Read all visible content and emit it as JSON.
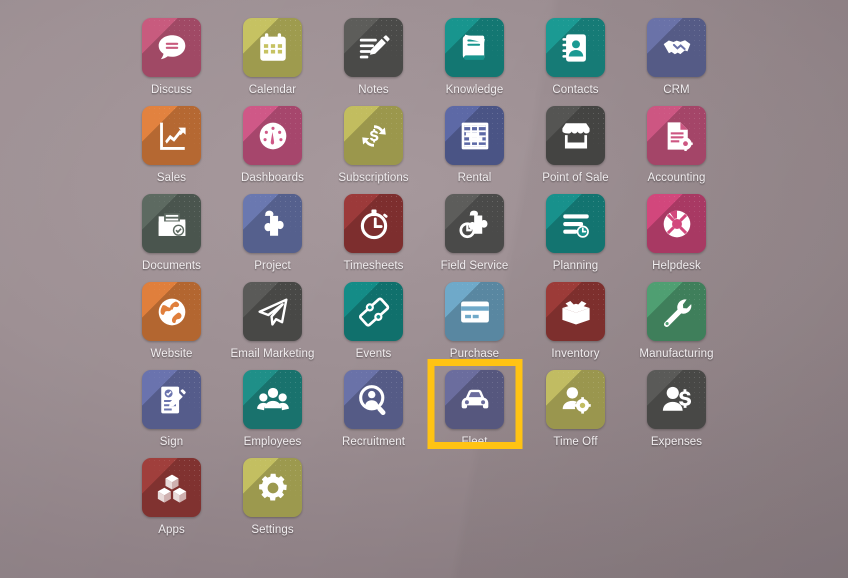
{
  "screen": {
    "type": "odoo-apps-home",
    "background_color": "#9a8c90",
    "highlight_color": "#ffc313",
    "highlighted_app": "Fleet",
    "columns": 6,
    "rows": 6
  },
  "apps": [
    {
      "label": "Discuss",
      "icon": "chat-bubble-icon",
      "color": "#c85b7e"
    },
    {
      "label": "Calendar",
      "icon": "calendar-icon",
      "color": "#c6c262"
    },
    {
      "label": "Notes",
      "icon": "note-pencil-icon",
      "color": "#5d5d5a"
    },
    {
      "label": "Knowledge",
      "icon": "book-icon",
      "color": "#18958e"
    },
    {
      "label": "Contacts",
      "icon": "address-book-icon",
      "color": "#1b9a93"
    },
    {
      "label": "CRM",
      "icon": "handshake-icon",
      "color": "#6a72a8"
    },
    {
      "label": "Sales",
      "icon": "growth-chart-icon",
      "color": "#e2823f"
    },
    {
      "label": "Dashboards",
      "icon": "gauge-icon",
      "color": "#cf5887"
    },
    {
      "label": "Subscriptions",
      "icon": "dollar-refresh-icon",
      "color": "#c2bd5f"
    },
    {
      "label": "Rental",
      "icon": "rental-grid-icon",
      "color": "#5d69a6"
    },
    {
      "label": "Point of Sale",
      "icon": "storefront-icon",
      "color": "#555553"
    },
    {
      "label": "Accounting",
      "icon": "invoice-gear-icon",
      "color": "#cd5682"
    },
    {
      "label": "Documents",
      "icon": "document-folder-icon",
      "color": "#5d6a61"
    },
    {
      "label": "Project",
      "icon": "puzzle-piece-icon",
      "color": "#6a78b0"
    },
    {
      "label": "Timesheets",
      "icon": "stopwatch-icon",
      "color": "#9c3a3a"
    },
    {
      "label": "Field Service",
      "icon": "puzzle-clock-icon",
      "color": "#5d5d5b"
    },
    {
      "label": "Planning",
      "icon": "planning-bars-icon",
      "color": "#18918c"
    },
    {
      "label": "Helpdesk",
      "icon": "lifebuoy-icon",
      "color": "#d2477c"
    },
    {
      "label": "Website",
      "icon": "globe-icon",
      "color": "#e07f3c"
    },
    {
      "label": "Email Marketing",
      "icon": "paper-plane-icon",
      "color": "#5a5a58"
    },
    {
      "label": "Events",
      "icon": "ticket-icon",
      "color": "#148c87"
    },
    {
      "label": "Purchase",
      "icon": "credit-card-icon",
      "color": "#6fa9c9"
    },
    {
      "label": "Inventory",
      "icon": "open-box-icon",
      "color": "#9c3b38"
    },
    {
      "label": "Manufacturing",
      "icon": "wrench-icon",
      "color": "#4f9f72"
    },
    {
      "label": "Sign",
      "icon": "signed-document-icon",
      "color": "#6a73ae"
    },
    {
      "label": "Employees",
      "icon": "people-group-icon",
      "color": "#1f8f88"
    },
    {
      "label": "Recruitment",
      "icon": "person-search-icon",
      "color": "#6a72a8"
    },
    {
      "label": "Fleet",
      "icon": "car-icon",
      "color": "#6b6d9e"
    },
    {
      "label": "Time Off",
      "icon": "person-gear-icon",
      "color": "#c1bc62"
    },
    {
      "label": "Expenses",
      "icon": "person-dollar-icon",
      "color": "#5a5a58"
    },
    {
      "label": "Apps",
      "icon": "cubes-icon",
      "color": "#a03f3c"
    },
    {
      "label": "Settings",
      "icon": "gear-icon",
      "color": "#c3bf61"
    }
  ]
}
